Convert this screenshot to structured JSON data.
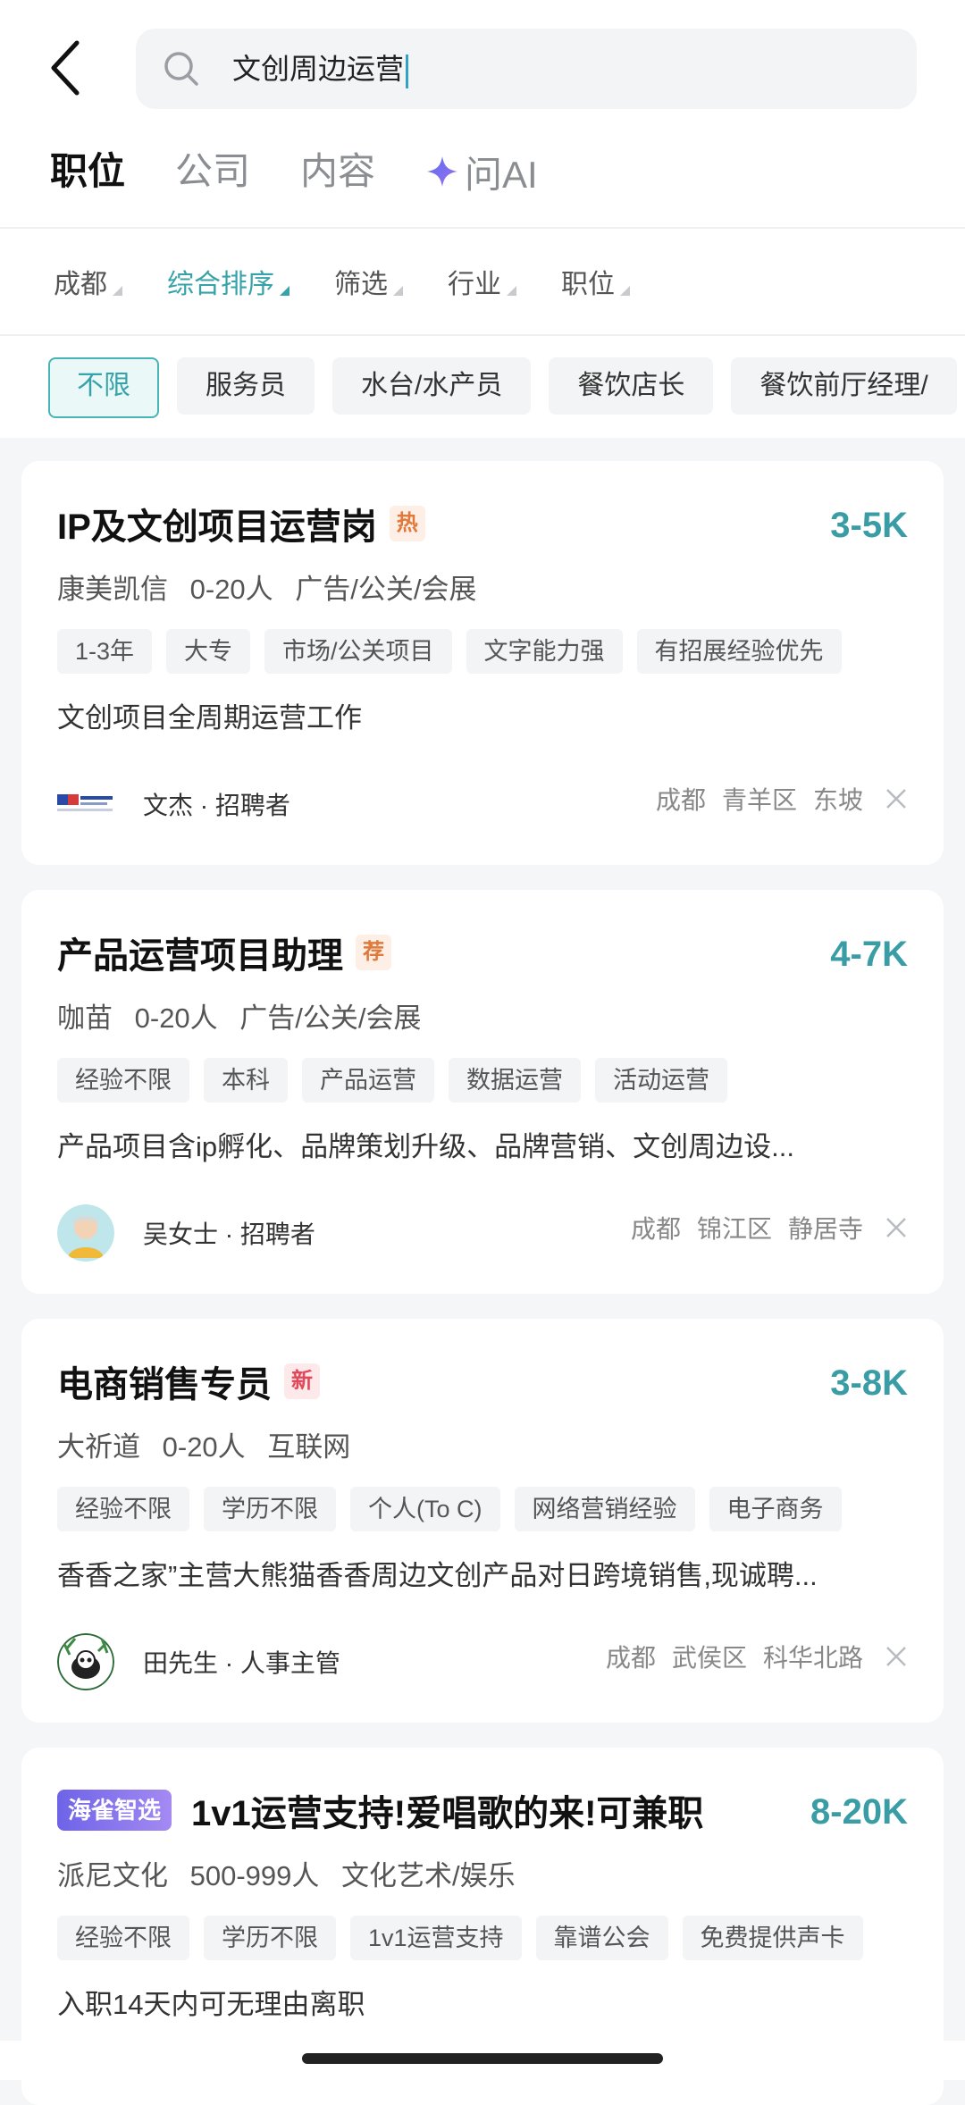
{
  "search": {
    "query": "文创周边运营"
  },
  "tabs": [
    {
      "label": "职位",
      "active": true
    },
    {
      "label": "公司"
    },
    {
      "label": "内容"
    },
    {
      "label": "问AI"
    }
  ],
  "filters": [
    {
      "label": "成都"
    },
    {
      "label": "综合排序",
      "active": true
    },
    {
      "label": "筛选"
    },
    {
      "label": "行业"
    },
    {
      "label": "职位"
    }
  ],
  "chips": [
    {
      "label": "不限",
      "active": true
    },
    {
      "label": "服务员"
    },
    {
      "label": "水台/水产员"
    },
    {
      "label": "餐饮店长"
    },
    {
      "label": "餐饮前厅经理/"
    }
  ],
  "jobs": [
    {
      "title": "IP及文创项目运营岗",
      "badge": "热",
      "salary": "3-5K",
      "company": "康美凯信",
      "size": "0-20人",
      "industry": "广告/公关/会展",
      "tags": [
        "1-3年",
        "大专",
        "市场/公关项目",
        "文字能力强",
        "有招展经验优先"
      ],
      "desc": "文创项目全周期运营工作",
      "recruiter": "文杰 · 招聘者",
      "city": "成都",
      "district": "青羊区",
      "area": "东坡"
    },
    {
      "title": "产品运营项目助理",
      "badge": "荐",
      "salary": "4-7K",
      "company": "咖苗",
      "size": "0-20人",
      "industry": "广告/公关/会展",
      "tags": [
        "经验不限",
        "本科",
        "产品运营",
        "数据运营",
        "活动运营"
      ],
      "desc": "产品项目含ip孵化、品牌策划升级、品牌营销、文创周边设...",
      "recruiter": "吴女士 · 招聘者",
      "city": "成都",
      "district": "锦江区",
      "area": "静居寺"
    },
    {
      "title": "电商销售专员",
      "badge": "新",
      "salary": "3-8K",
      "company": "大祈道",
      "size": "0-20人",
      "industry": "互联网",
      "tags": [
        "经验不限",
        "学历不限",
        "个人(To C)",
        "网络营销经验",
        "电子商务"
      ],
      "desc": "香香之家”主营大熊猫香香周边文创产品对日跨境销售,现诚聘...",
      "recruiter": "田先生 · 人事主管",
      "city": "成都",
      "district": "武侯区",
      "area": "科华北路"
    },
    {
      "ai_badge": "海雀智选",
      "title": "1v1运营支持!爱唱歌的来!可兼职",
      "salary": "8-20K",
      "company": "派尼文化",
      "size": "500-999人",
      "industry": "文化艺术/娱乐",
      "tags": [
        "经验不限",
        "学历不限",
        "1v1运营支持",
        "靠谱公会",
        "免费提供声卡"
      ],
      "desc": "入职14天内可无理由离职"
    }
  ],
  "colors": {
    "accent": "#3a9da6",
    "hot": "#e07a3c",
    "new": "#e2485a",
    "ai": "#6e63e8"
  }
}
